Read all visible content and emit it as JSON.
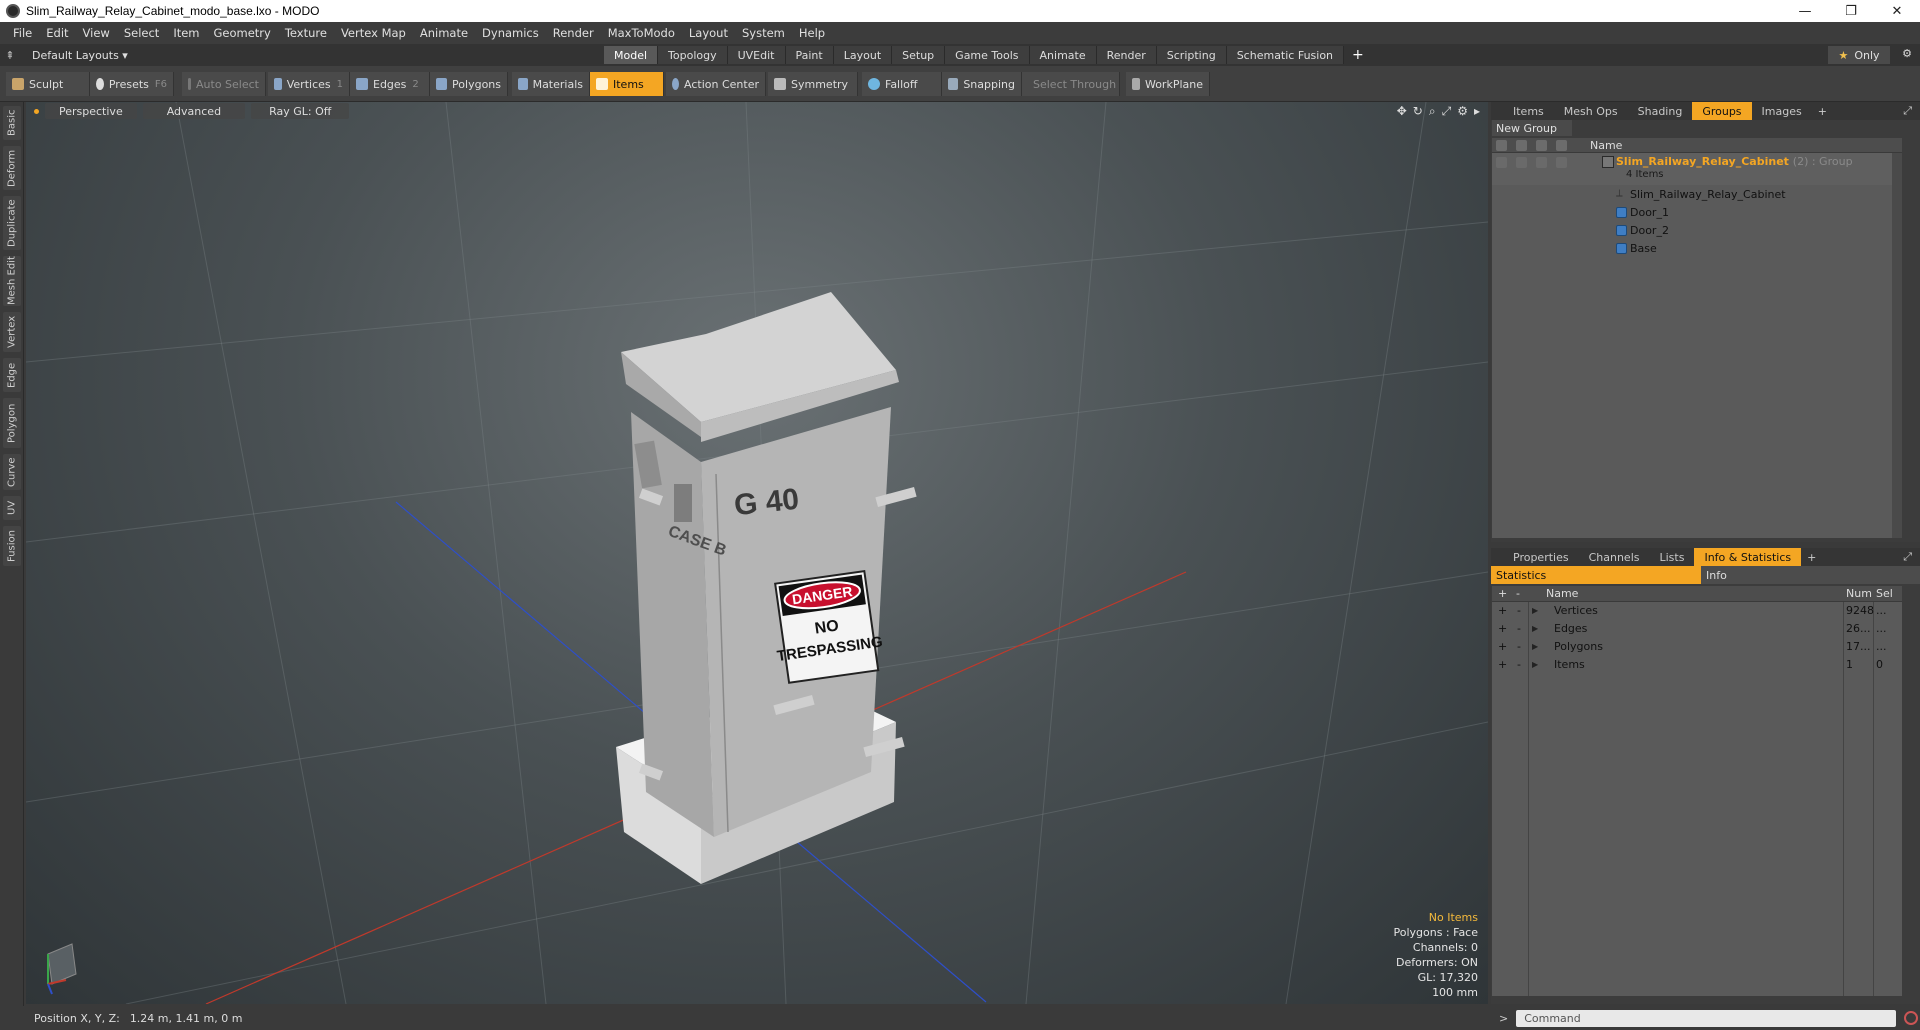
{
  "window": {
    "title": "Slim_Railway_Relay_Cabinet_modo_base.lxo - MODO",
    "minimize": "—",
    "maximize": "❐",
    "close": "✕"
  },
  "menu": [
    "File",
    "Edit",
    "View",
    "Select",
    "Item",
    "Geometry",
    "Texture",
    "Vertex Map",
    "Animate",
    "Dynamics",
    "Render",
    "MaxToModo",
    "Layout",
    "System",
    "Help"
  ],
  "layout_bar": {
    "layout_select": "Default Layouts ▾",
    "tabs": [
      "Model",
      "Topology",
      "UVEdit",
      "Paint",
      "Layout",
      "Setup",
      "Game Tools",
      "Animate",
      "Render",
      "Scripting",
      "Schematic Fusion"
    ],
    "active_tab": "Model",
    "add_tab": "+",
    "only_star": "★",
    "only_label": "Only",
    "gear": "⚙"
  },
  "toolbar": {
    "sculpt": "Sculpt",
    "presets": "Presets",
    "presets_key": "F6",
    "auto_select": "Auto Select",
    "vertices": "Vertices",
    "vertices_num": "1",
    "edges": "Edges",
    "edges_num": "2",
    "polygons": "Polygons",
    "materials": "Materials",
    "items": "Items",
    "action_center": "Action Center",
    "symmetry": "Symmetry",
    "falloff": "Falloff",
    "snapping": "Snapping",
    "select_through": "Select Through",
    "workplane": "WorkPlane"
  },
  "left_tabs": [
    "Basic",
    "Deform",
    "Duplicate",
    "Mesh Edit",
    "Vertex",
    "Edge",
    "Polygon",
    "Curve",
    "UV",
    "Fusion"
  ],
  "viewport": {
    "perspective": "Perspective",
    "advanced": "Advanced",
    "raygl": "Ray GL: Off",
    "icons": [
      "✥",
      "↻",
      "⌕",
      "⤢",
      "⚙",
      "▸"
    ],
    "model_text": {
      "code": "G 40",
      "case": "CASE B",
      "danger": "DANGER",
      "sign_line1": "NO",
      "sign_line2": "TRESPASSING"
    },
    "overlay": {
      "no_items": "No Items",
      "polygons": "Polygons : Face",
      "channels": "Channels: 0",
      "deformers": "Deformers: ON",
      "gl": "GL: 17,320",
      "scale": "100 mm"
    }
  },
  "status": {
    "position_label": "Position X, Y, Z:",
    "position_value": "1.24 m, 1.41 m, 0 m"
  },
  "groups_panel": {
    "tabs": [
      "Items",
      "Mesh Ops",
      "Shading",
      "Groups",
      "Images"
    ],
    "active_tab": "Groups",
    "plus": "+",
    "new_group": "New Group",
    "name_header": "Name",
    "group_name": "Slim_Railway_Relay_Cabinet",
    "group_suffix": "(2) : Group",
    "group_count": "4 Items",
    "children": [
      "Slim_Railway_Relay_Cabinet",
      "Door_1",
      "Door_2",
      "Base"
    ]
  },
  "info_panel": {
    "tabs": [
      "Properties",
      "Channels",
      "Lists",
      "Info & Statistics"
    ],
    "active_tab": "Info & Statistics",
    "plus": "+",
    "stats_tab": "Statistics",
    "info_tab": "Info",
    "headers": {
      "name": "Name",
      "num": "Num",
      "sel": "Sel"
    },
    "rows": [
      {
        "name": "Vertices",
        "num": "9248",
        "sel": "..."
      },
      {
        "name": "Edges",
        "num": "26...",
        "sel": "..."
      },
      {
        "name": "Polygons",
        "num": "17...",
        "sel": "..."
      },
      {
        "name": "Items",
        "num": "1",
        "sel": "0"
      }
    ]
  },
  "command": {
    "prompt": ">",
    "placeholder": "Command"
  },
  "colors": {
    "accent": "#f4a623",
    "x_axis": "#c0392b",
    "z_axis": "#2e4fc9",
    "danger_red": "#c8102e"
  }
}
